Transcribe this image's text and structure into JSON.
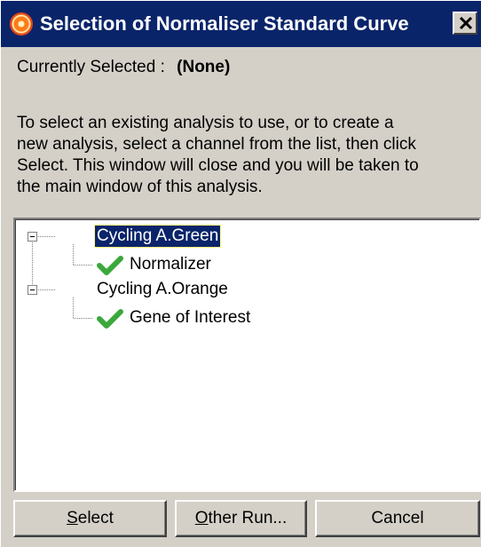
{
  "window": {
    "title": "Selection of Normaliser Standard Curve",
    "close_glyph": "✕"
  },
  "current": {
    "label": "Currently Selected :",
    "value": "(None)"
  },
  "instructions": "To select an existing analysis to use, or to create a\nnew analysis, select a channel from the list, then click\nSelect. This window will close and you will be taken to\nthe main window of this analysis.",
  "tree": {
    "nodes": [
      {
        "label": "Cycling A.Green",
        "selected": true,
        "children": [
          {
            "label": "Normalizer",
            "icon": "check-icon"
          }
        ]
      },
      {
        "label": "Cycling A.Orange",
        "selected": false,
        "children": [
          {
            "label": "Gene of Interest",
            "icon": "check-icon"
          }
        ]
      }
    ]
  },
  "buttons": {
    "select": {
      "mnemonic": "S",
      "rest": "elect"
    },
    "other_run": {
      "mnemonic": "O",
      "rest": "ther Run..."
    },
    "cancel": {
      "label": "Cancel"
    }
  },
  "colors": {
    "titlebar": "#0a246a",
    "dialog_bg": "#d4d0c8",
    "check_green": "#3aa83a",
    "selection": "#0a246a"
  }
}
